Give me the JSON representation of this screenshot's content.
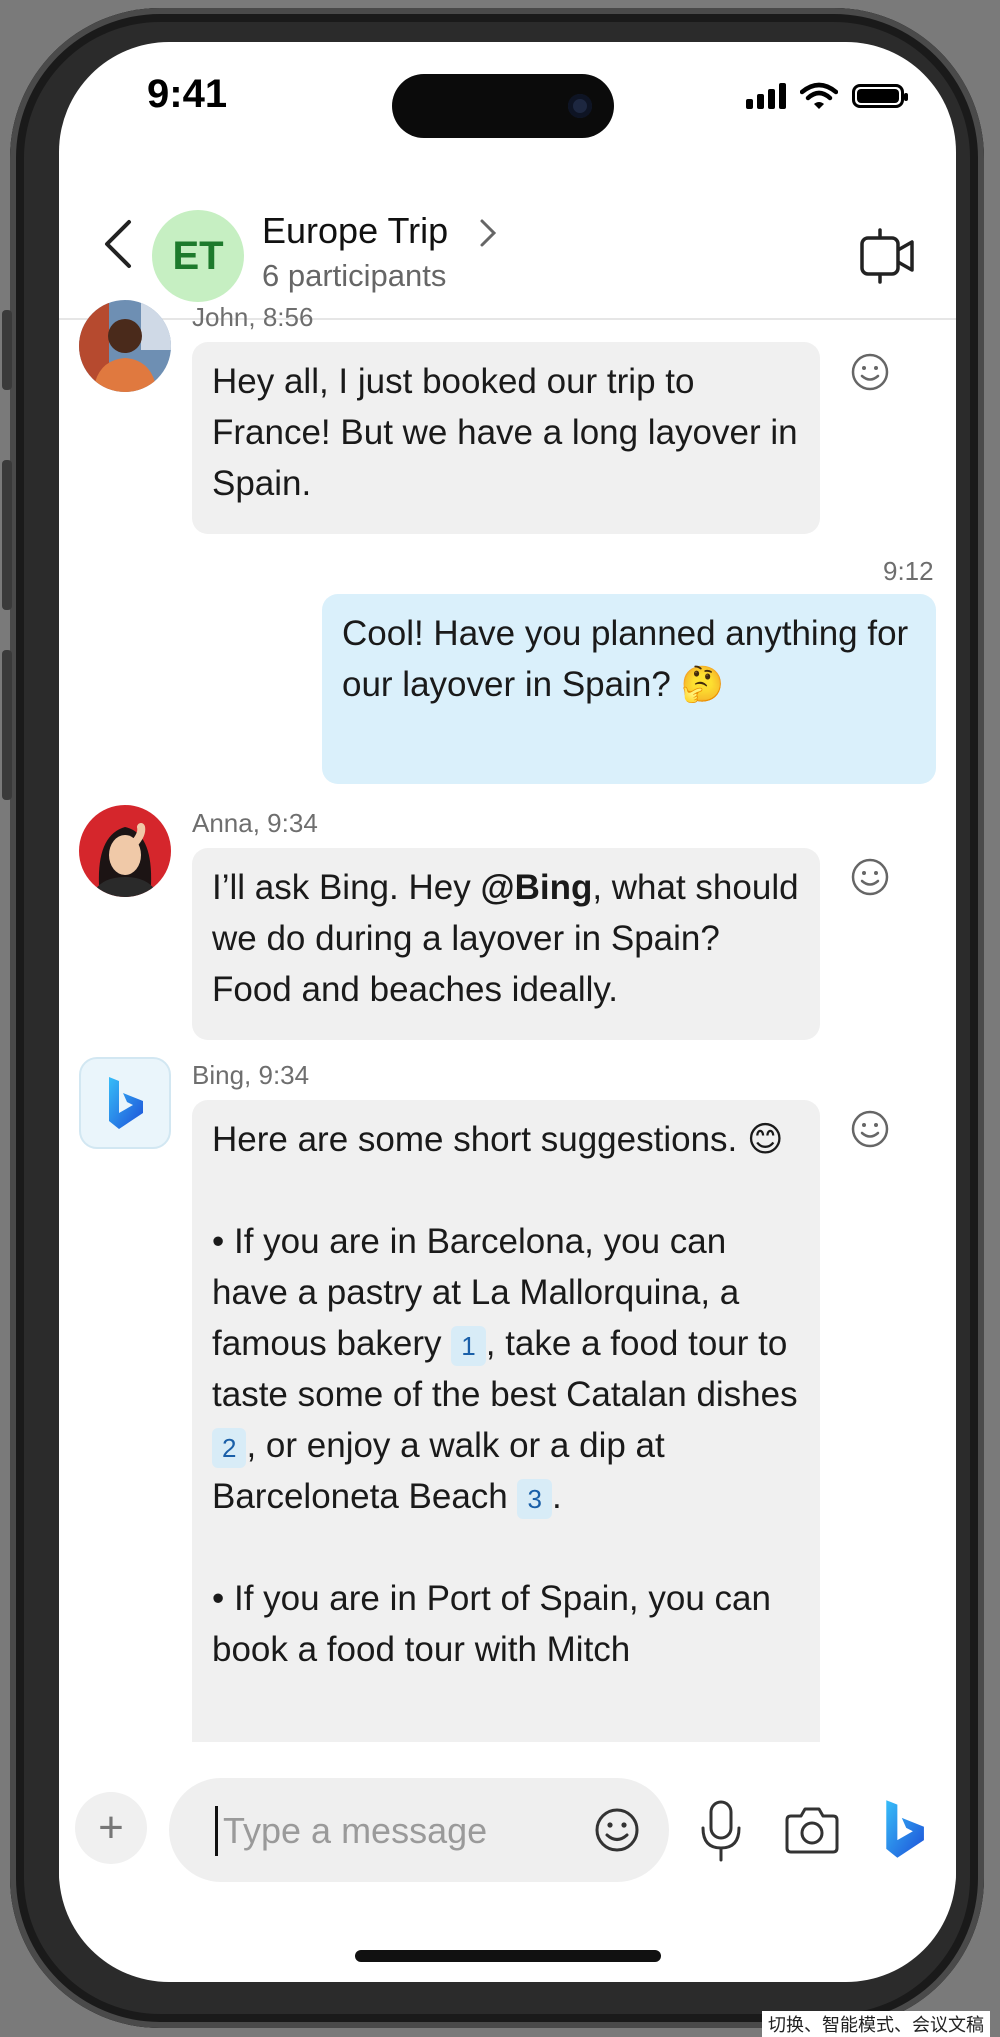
{
  "status_bar": {
    "time": "9:41"
  },
  "header": {
    "avatar_initials": "ET",
    "title": "Europe Trip",
    "subtitle": "6 participants",
    "icons": {
      "back": "chevron-left-icon",
      "chevron": "chevron-right-icon",
      "video": "video-call-icon"
    }
  },
  "messages": [
    {
      "sender_meta": "John, 8:56",
      "text": "Hey all, I just booked our trip to France! But we have a long layover in Spain."
    },
    {
      "time": "9:12",
      "text": "Cool! Have you planned anything for our layover in Spain? 🤔"
    },
    {
      "sender_meta": "Anna, 9:34",
      "text_before": "I’ll ask Bing. Hey ",
      "mention": "@Bing",
      "text_after": ", what should we do during a layover in Spain? Food and beaches ideally."
    },
    {
      "sender_meta": "Bing, 9:34",
      "intro": "Here are some short suggestions. 😊",
      "bullet1_a": "• If you are in Barcelona, you can have a pastry at La Mallorquina, a famous bakery ",
      "cite1": "1",
      "bullet1_b": ", take a food tour to taste some of the best Catalan dishes ",
      "cite2": "2",
      "bullet1_c": ", or enjoy a walk or a dip at Barceloneta Beach ",
      "cite3": "3",
      "bullet1_d": ".",
      "bullet2": "• If you are in Port of Spain, you can book a food tour with Mitch"
    }
  ],
  "composer": {
    "placeholder": "Type a message"
  },
  "footer_stray_text": "切换、智能模式、会议文稿"
}
